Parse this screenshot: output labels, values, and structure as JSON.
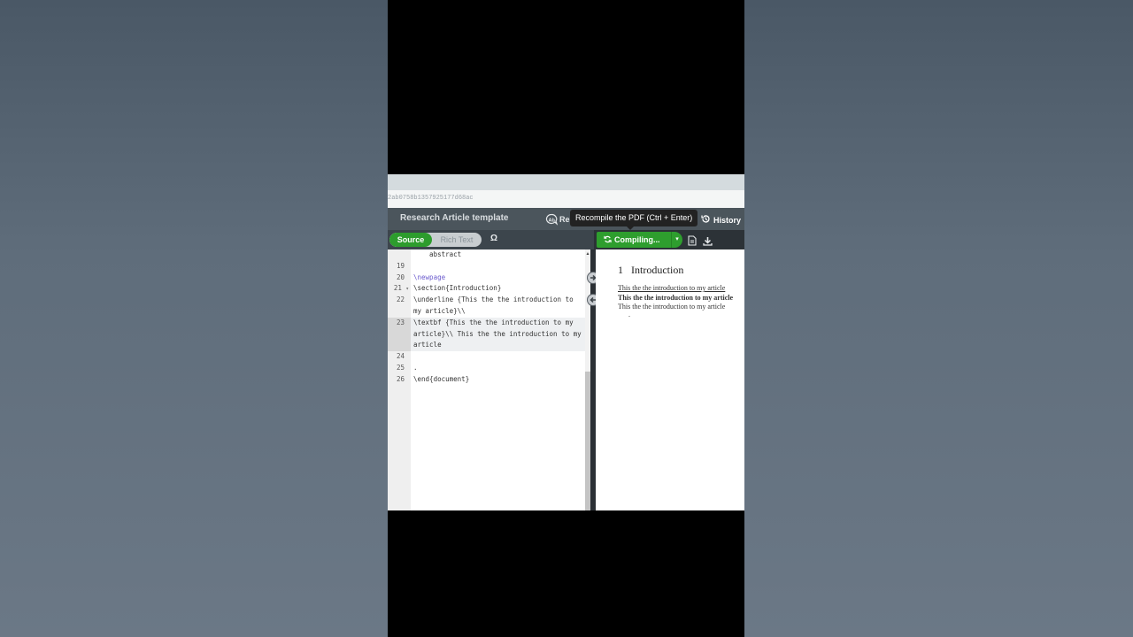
{
  "browser": {
    "url": "2ab0758b1357925177d68ac"
  },
  "header": {
    "project_title": "Research Article template",
    "review_label": "Re",
    "tooltip": "Recompile the PDF (Ctrl + Enter)",
    "history_label": "History"
  },
  "toolbar": {
    "source_label": "Source",
    "rich_text_label": "Rich Text",
    "symbol_label": "Ω",
    "compile_label": "Compiling...",
    "compile_dropdown": "▾"
  },
  "editor": {
    "lines": [
      {
        "num": "",
        "text": "    abstract"
      },
      {
        "num": "19",
        "text": ""
      },
      {
        "num": "20",
        "text": "\\newpage"
      },
      {
        "num": "21",
        "text": "\\section{Introduction}"
      },
      {
        "num": "22",
        "text": "\\underline {This the the introduction to"
      },
      {
        "num": "",
        "text": "my article}\\\\"
      },
      {
        "num": "23",
        "text": "\\textbf {This the the introduction to my"
      },
      {
        "num": "",
        "text": "article}\\\\ This the the introduction to my"
      },
      {
        "num": "",
        "text": "article"
      },
      {
        "num": "24",
        "text": ""
      },
      {
        "num": "25",
        "text": "."
      },
      {
        "num": "26",
        "text": "\\end{document}"
      }
    ]
  },
  "pdf": {
    "section_number": "1",
    "section_title": "Introduction",
    "lines": [
      "This the the introduction to my article",
      "This the the introduction to my article",
      "This the the introduction to my article",
      "."
    ]
  }
}
